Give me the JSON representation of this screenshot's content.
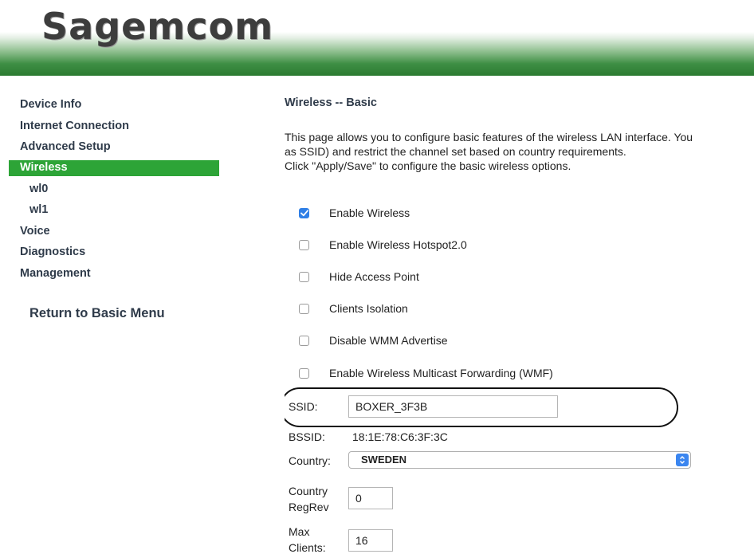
{
  "header": {
    "logo_text": "Sagemcom"
  },
  "sidebar": {
    "items": [
      {
        "label": "Device Info"
      },
      {
        "label": "Internet Connection"
      },
      {
        "label": "Advanced Setup"
      },
      {
        "label": "Wireless",
        "active": true
      },
      {
        "label": "wl0",
        "sub": true
      },
      {
        "label": "wl1",
        "sub": true
      },
      {
        "label": "Voice"
      },
      {
        "label": "Diagnostics"
      },
      {
        "label": "Management"
      }
    ],
    "return_link": "Return to Basic Menu"
  },
  "main": {
    "title": "Wireless -- Basic",
    "description": [
      "This page allows you to configure basic features of the wireless LAN interface. You",
      "as SSID) and restrict the channel set based on country requirements.",
      "Click \"Apply/Save\" to configure the basic wireless options."
    ],
    "options": [
      {
        "label": "Enable Wireless",
        "checked": true
      },
      {
        "label": "Enable Wireless Hotspot2.0",
        "checked": false
      },
      {
        "label": "Hide Access Point",
        "checked": false
      },
      {
        "label": "Clients Isolation",
        "checked": false
      },
      {
        "label": "Disable WMM Advertise",
        "checked": false
      },
      {
        "label": "Enable Wireless Multicast Forwarding (WMF)",
        "checked": false
      }
    ],
    "ssid": {
      "label": "SSID:",
      "value": "BOXER_3F3B"
    },
    "bssid": {
      "label": "BSSID:",
      "value": "18:1E:78:C6:3F:3C"
    },
    "country": {
      "label": "Country:",
      "value": "SWEDEN"
    },
    "country_regrev": {
      "label_line1": "Country",
      "label_line2": "RegRev",
      "value": "0"
    },
    "max_clients": {
      "label_line1": "Max",
      "label_line2": "Clients:",
      "value": "16"
    }
  },
  "colors": {
    "header_green": "#2a7a30",
    "active_nav": "#2da437",
    "checkbox_checked": "#2f7fe6",
    "nav_text": "#2f3b4a"
  }
}
